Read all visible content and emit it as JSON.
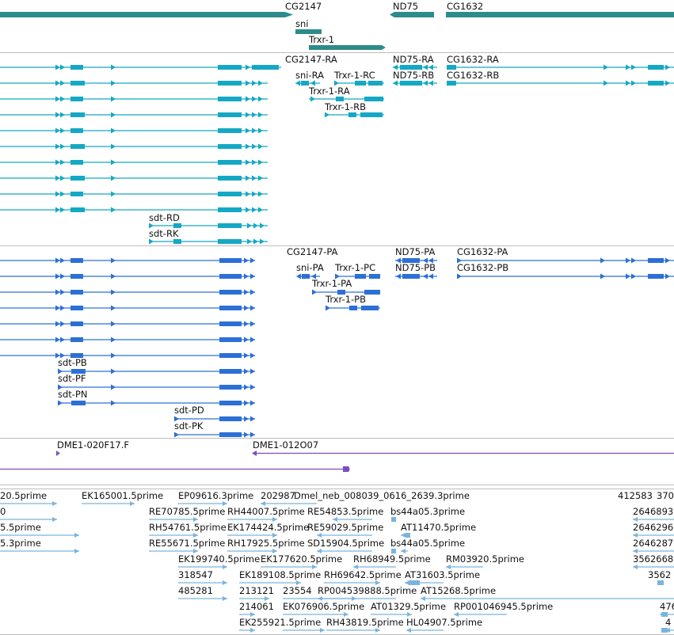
{
  "colors": {
    "gene": "#2e8b8b",
    "transcript": "#15a8c4",
    "protein": "#2c6fd6",
    "clone": "#7a4ec0",
    "est": "#7ab4dc",
    "divider": "#bdbdbd"
  },
  "tracks": {
    "genes": {
      "labels": [
        "CG2147",
        "sni",
        "Trxr-1",
        "ND75",
        "CG1632"
      ]
    },
    "transcripts": {
      "labels": [
        "CG2147-RA",
        "sni-RA",
        "Trxr-1-RC",
        "Trxr-1-RA",
        "Trxr-1-RB",
        "ND75-RA",
        "ND75-RB",
        "CG1632-RA",
        "CG1632-RB",
        "sdt-RD",
        "sdt-RK"
      ]
    },
    "proteins": {
      "labels": [
        "CG2147-PA",
        "sni-PA",
        "Trxr-1-PC",
        "Trxr-1-PA",
        "Trxr-1-PB",
        "ND75-PA",
        "ND75-PB",
        "CG1632-PA",
        "CG1632-PB",
        "sdt-PB",
        "sdt-PF",
        "sdt-PN",
        "sdt-PD",
        "sdt-PK"
      ]
    },
    "clones": {
      "labels": [
        "DME1-020F17.F",
        "DME1-012O07"
      ]
    },
    "ests": {
      "labels": [
        "20.5prime",
        "EK165001.5prime",
        "EP09616.3prime",
        "202987",
        "Dmel_neb_008039_0616_2639.3prime",
        "412583",
        "370",
        "0",
        "RE70785.5prime",
        "RH44007.5prime",
        "RE54853.5prime",
        "bs44a05.3prime",
        "2646893",
        "5.5prime",
        "RH54761.5prime",
        "EK174424.5prime",
        "RE59029.5prime",
        "AT11470.5prime",
        "2646296",
        "5.3prime",
        "RE55671.5prime",
        "RH17925.5prime",
        "SD15904.5prime",
        "bs44a05.5prime",
        "2646287",
        "EK199740.5prime",
        "EK177620.5prime",
        "RH68949.5prime",
        "RM03920.5prime",
        "3562668",
        "318547",
        "EK189108.5prime",
        "RH69642.5prime",
        "AT31603.5prime",
        "3562",
        "485281",
        "213121",
        "23554",
        "RP004539888.5prime",
        "AT15268.5prime",
        "214061",
        "EK076906.5prime",
        "AT01329.5prime",
        "RP001046945.5prime",
        "476",
        "EK255921.5prime",
        "RH43819.5prime",
        "HL04907.5prime",
        "4"
      ]
    }
  }
}
